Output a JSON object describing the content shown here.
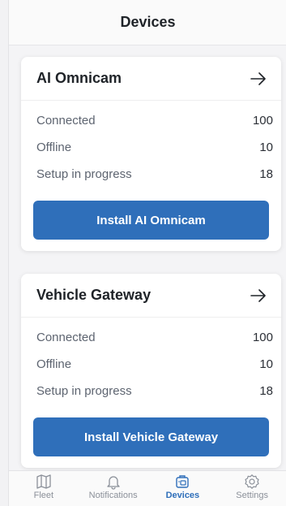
{
  "header": {
    "title": "Devices"
  },
  "cards": [
    {
      "title": "AI Omnicam",
      "rows": [
        {
          "label": "Connected",
          "value": "100"
        },
        {
          "label": "Offline",
          "value": "10"
        },
        {
          "label": "Setup in progress",
          "value": "18"
        }
      ],
      "button_label": "Install AI Omnicam"
    },
    {
      "title": "Vehicle Gateway",
      "rows": [
        {
          "label": "Connected",
          "value": "100"
        },
        {
          "label": "Offline",
          "value": "10"
        },
        {
          "label": "Setup in progress",
          "value": "18"
        }
      ],
      "button_label": "Install Vehicle Gateway"
    }
  ],
  "tabbar": {
    "tabs": [
      {
        "label": "Fleet",
        "icon": "map-icon"
      },
      {
        "label": "Notifications",
        "icon": "bell-icon"
      },
      {
        "label": "Devices",
        "icon": "devices-icon",
        "active": true
      },
      {
        "label": "Settings",
        "icon": "gear-icon"
      }
    ]
  },
  "colors": {
    "accent": "#2f6fba",
    "inactive": "#8b9099"
  }
}
